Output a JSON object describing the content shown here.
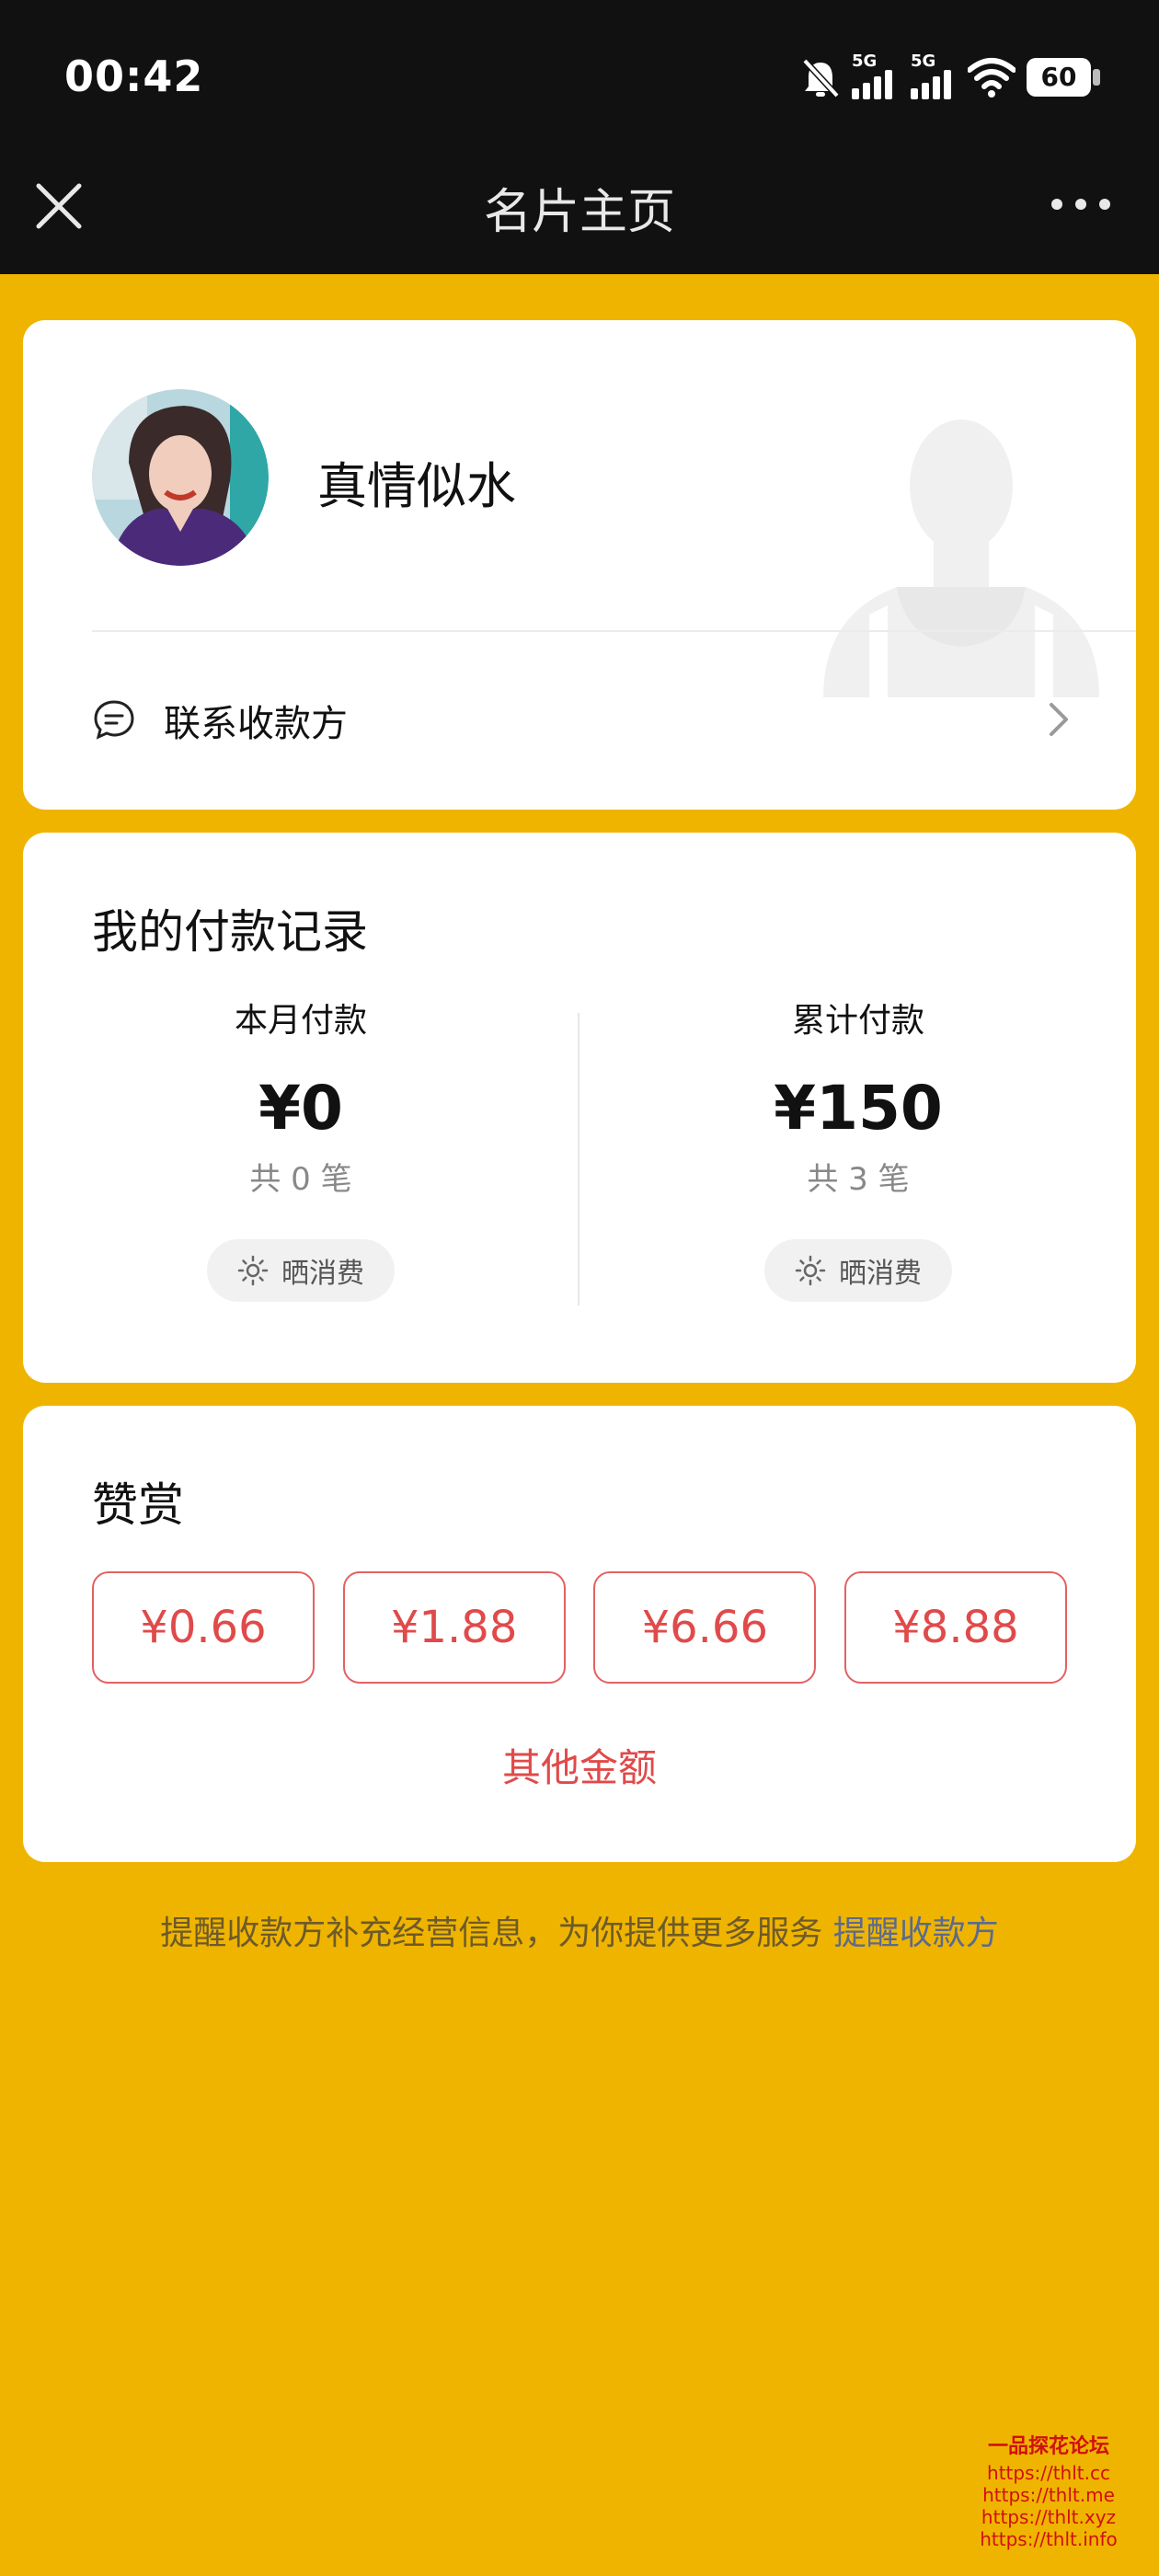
{
  "status_bar": {
    "time": "00:42",
    "battery": "60",
    "network_1": "5G",
    "network_2": "5G"
  },
  "nav": {
    "title": "名片主页"
  },
  "profile": {
    "name": "真情似水",
    "contact_label": "联系收款方"
  },
  "records": {
    "title": "我的付款记录",
    "month": {
      "label": "本月付款",
      "amount": "¥0",
      "count": "共 0 笔",
      "share_label": "晒消费"
    },
    "total": {
      "label": "累计付款",
      "amount": "¥150",
      "count": "共 3 笔",
      "share_label": "晒消费"
    }
  },
  "reward": {
    "title": "赞赏",
    "options": [
      "¥0.66",
      "¥1.88",
      "¥6.66",
      "¥8.88"
    ],
    "other_label": "其他金额"
  },
  "footer": {
    "text": "提醒收款方补充经营信息，为你提供更多服务 ",
    "link_label": "提醒收款方"
  },
  "watermark": {
    "title": "一品探花论坛",
    "lines": [
      "https://thlt.cc",
      "https://thlt.me",
      "https://thlt.xyz",
      "https://thlt.info"
    ]
  },
  "colors": {
    "background": "#EFB400",
    "accent_red": "#E04A4A",
    "link_blue": "#5b6a8f"
  }
}
